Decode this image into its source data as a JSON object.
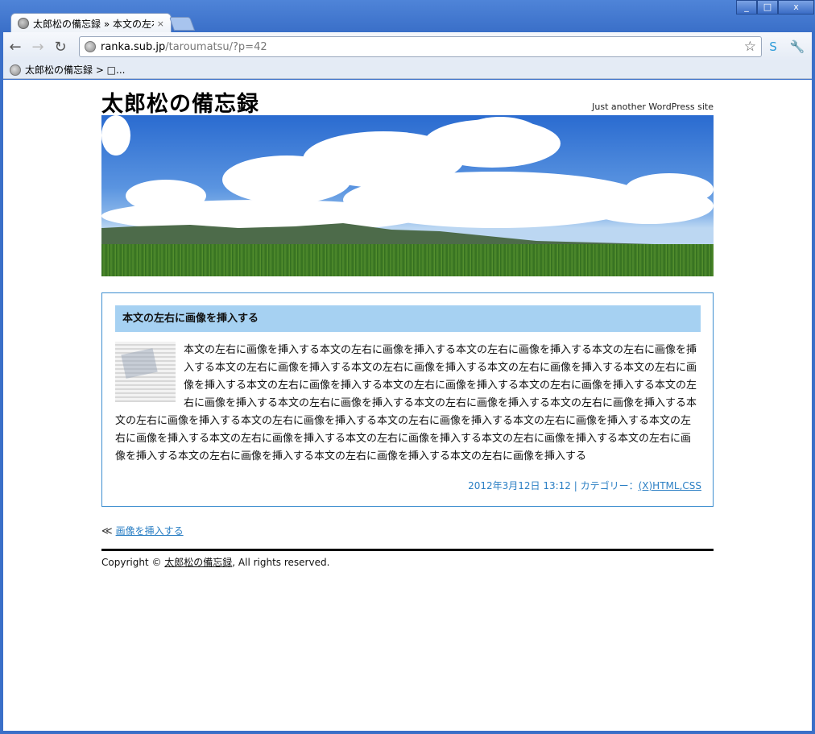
{
  "browser": {
    "tab_title": "太郎松の備忘録 » 本文の左右",
    "tab_close": "×",
    "window_controls": [
      "_",
      "□",
      "x"
    ],
    "address_host": "ranka.sub.jp",
    "address_path": "/taroumatsu/?p=42",
    "bookmark_label": "太郎松の備忘録 > □..."
  },
  "site": {
    "title": "太郎松の備忘録",
    "tagline": "Just another WordPress site"
  },
  "article": {
    "title": "本文の左右に画像を挿入する",
    "body": "本文の左右に画像を挿入する本文の左右に画像を挿入する本文の左右に画像を挿入する本文の左右に画像を挿入する本文の左右に画像を挿入する本文の左右に画像を挿入する本文の左右に画像を挿入する本文の左右に画像を挿入する本文の左右に画像を挿入する本文の左右に画像を挿入する本文の左右に画像を挿入する本文の左右に画像を挿入する本文の左右に画像を挿入する本文の左右に画像を挿入する本文の左右に画像を挿入する本文の左右に画像を挿入する本文の左右に画像を挿入する本文の左右に画像を挿入する本文の左右に画像を挿入する本文の左右に画像を挿入する本文の左右に画像を挿入する本文の左右に画像を挿入する本文の左右に画像を挿入する本文の左右に画像を挿入する本文の左右に画像を挿入する本文の左右に画像を挿入する本文の左右に画像を挿入する",
    "meta_date": "2012年3月12日 13:12 | カテゴリー：",
    "meta_category": "(X)HTML,CSS"
  },
  "navigation": {
    "prev_arrow": "≪",
    "prev_label": "画像を挿入する"
  },
  "footer": {
    "prefix": "Copyright © ",
    "site_link": "太郎松の備忘録",
    "suffix": ", All rights reserved."
  },
  "colors": {
    "accent": "#2b7fc4",
    "title_bg": "#a6d1f2",
    "border": "#3d8ecf"
  }
}
